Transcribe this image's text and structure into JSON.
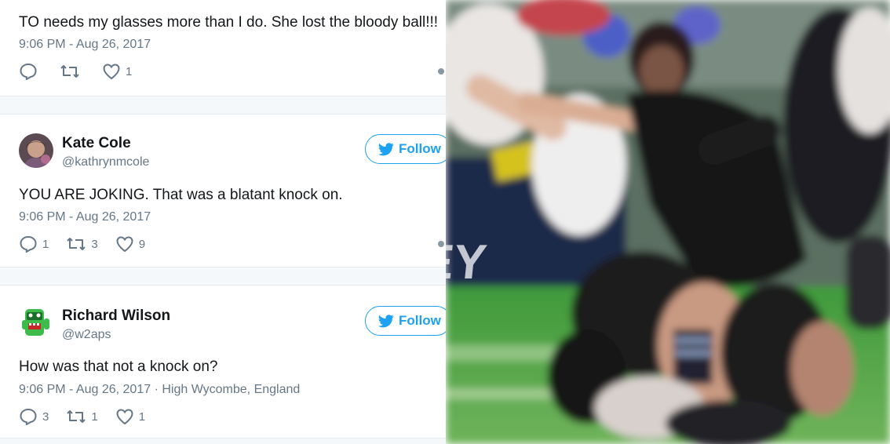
{
  "tweets": [
    {
      "text": "TO needs my glasses more than I do. She lost the bloody ball!!!",
      "meta": "9:06 PM - Aug 26, 2017",
      "replies": "",
      "retweets": "",
      "likes": "1"
    },
    {
      "name": "Kate Cole",
      "handle": "@kathrynmcole",
      "follow_label": "Follow",
      "text": "YOU ARE JOKING. That was a blatant knock on.",
      "meta": "9:06 PM - Aug 26, 2017",
      "replies": "1",
      "retweets": "3",
      "likes": "9"
    },
    {
      "name": "Richard Wilson",
      "handle": "@w2aps",
      "follow_label": "Follow",
      "text": "How was that not a knock on?",
      "meta": "9:06 PM - Aug 26, 2017 · High Wycombe, England",
      "replies": "3",
      "retweets": "1",
      "likes": "1"
    }
  ],
  "photo": {
    "banner_text": "EY"
  },
  "colors": {
    "accent": "#1da1f2",
    "secondary_text": "#657786",
    "primary_text": "#14171a"
  }
}
